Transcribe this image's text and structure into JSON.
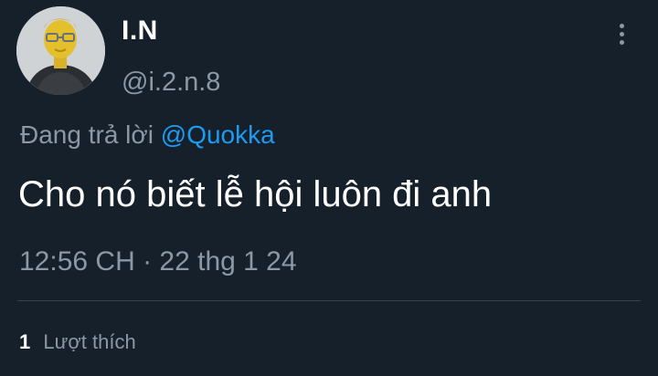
{
  "tweet": {
    "author": {
      "display_name": "I.N",
      "handle": "@i.2.n.8",
      "avatar_icon": "avatar"
    },
    "more_icon": "more-vertical-icon",
    "reply": {
      "prefix": "Đang trả lời",
      "mention": "@Quokka"
    },
    "text": "Cho nó biết lễ hội luôn đi anh",
    "timestamp": "12:56 CH · 22 thg 1 24",
    "stats": {
      "like_count": "1",
      "like_label": "Lượt thích"
    }
  },
  "colors": {
    "background": "#15202b",
    "primary_text": "#ffffff",
    "secondary_text": "#8b98a5",
    "accent": "#1d9bf0",
    "divider": "#38444d"
  }
}
